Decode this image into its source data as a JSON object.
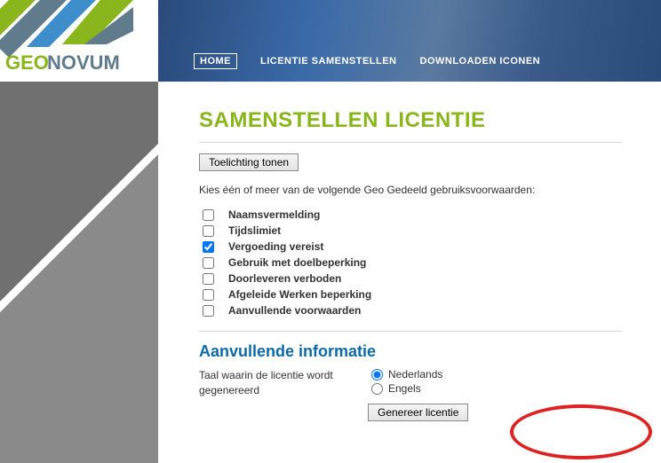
{
  "brand": {
    "name_prefix": "GEO",
    "name_suffix": "NOVUM"
  },
  "nav": {
    "home": "HOME",
    "compose": "LICENTIE SAMENSTELLEN",
    "download": "DOWNLOADEN ICONEN"
  },
  "page": {
    "title": "SAMENSTELLEN LICENTIE",
    "toggle_help": "Toelichting tonen",
    "instruction": "Kies één of meer van de volgende Geo Gedeeld gebruiksvoorwaarden:"
  },
  "options": [
    {
      "label": "Naamsvermelding",
      "checked": false
    },
    {
      "label": "Tijdslimiet",
      "checked": false
    },
    {
      "label": "Vergoeding vereist",
      "checked": true
    },
    {
      "label": "Gebruik met doelbeperking",
      "checked": false
    },
    {
      "label": "Doorleveren verboden",
      "checked": false
    },
    {
      "label": "Afgeleide Werken beperking",
      "checked": false
    },
    {
      "label": "Aanvullende voorwaarden",
      "checked": false
    }
  ],
  "extra": {
    "title": "Aanvullende informatie",
    "lang_label": "Taal waarin de licentie wordt gegenereerd",
    "lang_options": {
      "nl": "Nederlands",
      "en": "Engels"
    },
    "lang_selected": "nl",
    "generate": "Genereer licentie"
  }
}
